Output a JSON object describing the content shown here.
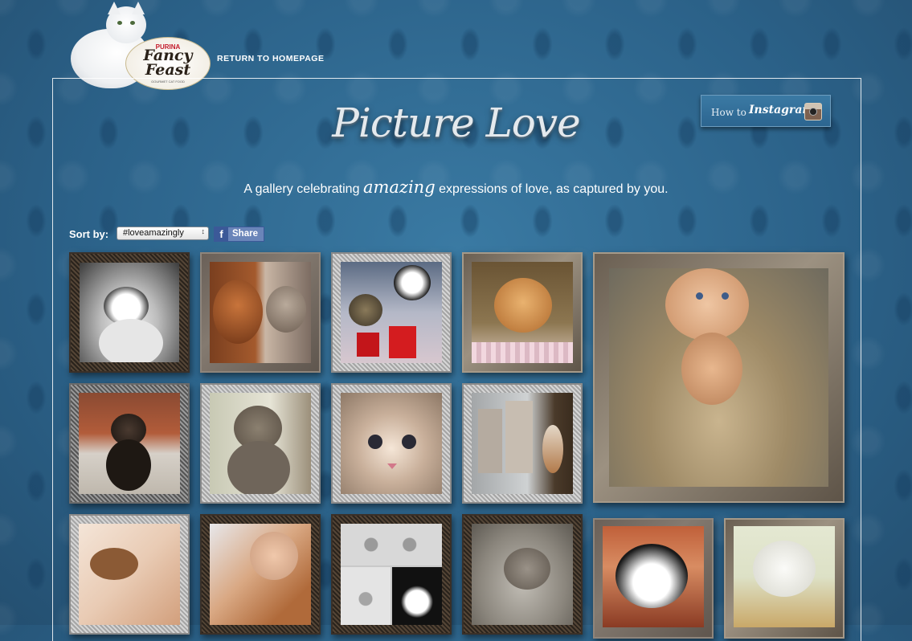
{
  "header": {
    "logo": {
      "brand_small": "PURINA",
      "brand_line1": "Fancy",
      "brand_line2": "Feast",
      "tagline": "GOURMET CAT FOOD"
    },
    "return_link": "RETURN TO HOMEPAGE"
  },
  "instagram_button": {
    "prefix": "How to",
    "brand": "Instagram",
    "icon": "camera-icon"
  },
  "main": {
    "title": "Picture Love",
    "subtitle_before": "A gallery celebrating",
    "subtitle_emphasis": "amazing",
    "subtitle_after": "expressions of love, as captured by you."
  },
  "controls": {
    "sort_label": "Sort by:",
    "sort_selected": "#loveamazingly",
    "share_icon": "facebook-f-icon",
    "share_label": "Share"
  },
  "gallery": {
    "photos": [
      {
        "row": 1,
        "col": 1,
        "subject": "black and white cat",
        "frame": "dark"
      },
      {
        "row": 1,
        "col": 2,
        "subject": "dog and tabby cat",
        "frame": "wood"
      },
      {
        "row": 1,
        "col": 3,
        "subject": "two cats with red bags",
        "frame": "silver"
      },
      {
        "row": 1,
        "col": 4,
        "subject": "orange cat in blanket",
        "frame": "gold"
      },
      {
        "row": 1,
        "col": 5,
        "subject": "orange kitten walking on hay",
        "frame": "gold",
        "featured": true
      },
      {
        "row": 2,
        "col": 1,
        "subject": "tortoiseshell cat by fireplace",
        "frame": "checker"
      },
      {
        "row": 2,
        "col": 2,
        "subject": "grey tabby cat",
        "frame": "silver"
      },
      {
        "row": 2,
        "col": 3,
        "subject": "tabby kitten face closeup",
        "frame": "silver"
      },
      {
        "row": 2,
        "col": 4,
        "subject": "calico cat at city window",
        "frame": "silver"
      },
      {
        "row": 3,
        "col": 1,
        "subject": "calico cat sleeping",
        "frame": "silver"
      },
      {
        "row": 3,
        "col": 2,
        "subject": "girl sleeping with orange cat",
        "frame": "dark"
      },
      {
        "row": 3,
        "col": 3,
        "subject": "paw prints collage",
        "frame": "dark"
      },
      {
        "row": 3,
        "col": 4,
        "subject": "tabby cat lying down",
        "frame": "dark"
      },
      {
        "row": 3,
        "col": 5,
        "subject": "calico cat upside down",
        "frame": "wood"
      },
      {
        "row": 3,
        "col": 6,
        "subject": "white cat squinting",
        "frame": "gold"
      }
    ]
  },
  "colors": {
    "background": "#2f6a92",
    "panel_border": "#ffffff",
    "facebook": "#3b5998"
  }
}
